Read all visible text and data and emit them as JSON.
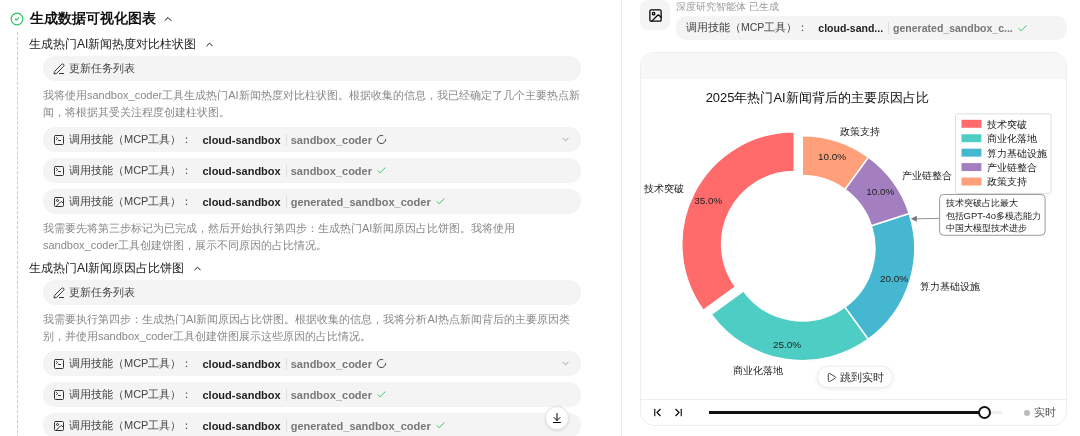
{
  "left": {
    "title": "生成数据可视化图表",
    "done": true,
    "expanded": true,
    "groups": [
      {
        "title": "生成热门AI新闻热度对比柱状图",
        "expanded": true,
        "items": [
          {
            "kind": "task",
            "label": "更新任务列表"
          },
          {
            "kind": "text",
            "text": "我将使用sandbox_coder工具生成热门AI新闻热度对比柱状图。根据收集的信息，我已经确定了几个主要热点新闻，将根据其受关注程度创建柱状图。"
          },
          {
            "kind": "call",
            "label": "调用技能（MCP工具）：",
            "server": "cloud-sandbox",
            "tool": "sandbox_coder",
            "done": false
          },
          {
            "kind": "call",
            "label": "调用技能（MCP工具）：",
            "server": "cloud-sandbox",
            "tool": "sandbox_coder",
            "done": true
          },
          {
            "kind": "output",
            "label": "调用技能（MCP工具）：",
            "server": "cloud-sandbox",
            "tool": "generated_sandbox_coder",
            "done": true
          },
          {
            "kind": "text",
            "text": "我需要先将第三步标记为已完成，然后开始执行第四步：生成热门AI新闻原因占比饼图。我将使用sandbox_coder工具创建饼图，展示不同原因的占比情况。"
          }
        ]
      },
      {
        "title": "生成热门AI新闻原因占比饼图",
        "expanded": true,
        "items": [
          {
            "kind": "task",
            "label": "更新任务列表"
          },
          {
            "kind": "text",
            "text": "我需要执行第四步：生成热门AI新闻原因占比饼图。根据收集的信息，我将分析AI热点新闻背后的主要原因类别，并使用sandbox_coder工具创建饼图展示这些原因的占比情况。"
          },
          {
            "kind": "call",
            "label": "调用技能（MCP工具）：",
            "server": "cloud-sandbox",
            "tool": "sandbox_coder",
            "done": false
          },
          {
            "kind": "call",
            "label": "调用技能（MCP工具）：",
            "server": "cloud-sandbox",
            "tool": "sandbox_coder",
            "done": true
          },
          {
            "kind": "output",
            "label": "调用技能（MCP工具）：",
            "server": "cloud-sandbox",
            "tool": "generated_sandbox_coder",
            "done": true
          }
        ]
      }
    ]
  },
  "right": {
    "agent_status": "深度研究智能体 已生成",
    "tool_call": {
      "label": "调用技能（MCP工具）：",
      "server": "cloud-sand...",
      "tool": "generated_sandbox_c...",
      "done": true
    },
    "chart_data": {
      "type": "donut",
      "title": "2025年热门AI新闻背后的主要原因占比",
      "categories": [
        "技术突破",
        "商业化落地",
        "算力基础设施",
        "产业链整合",
        "政策支持"
      ],
      "values": [
        35,
        25,
        20,
        10,
        10
      ],
      "colors": [
        "#ff6b6b",
        "#4ecdc4",
        "#45b7d1",
        "#a37fbf",
        "#ffa07a"
      ],
      "value_labels": [
        "35.0%",
        "25.0%",
        "20.0%",
        "10.0%",
        "10.0%"
      ],
      "legend": true,
      "annotations": [
        {
          "text": [
            "技术突破占比最大",
            "包括GPT-4o多模态能力",
            "中国大模型技术进步"
          ]
        }
      ]
    },
    "jump_button": "跳到实时",
    "player": {
      "level": 0.94,
      "live_label": "实时"
    }
  }
}
